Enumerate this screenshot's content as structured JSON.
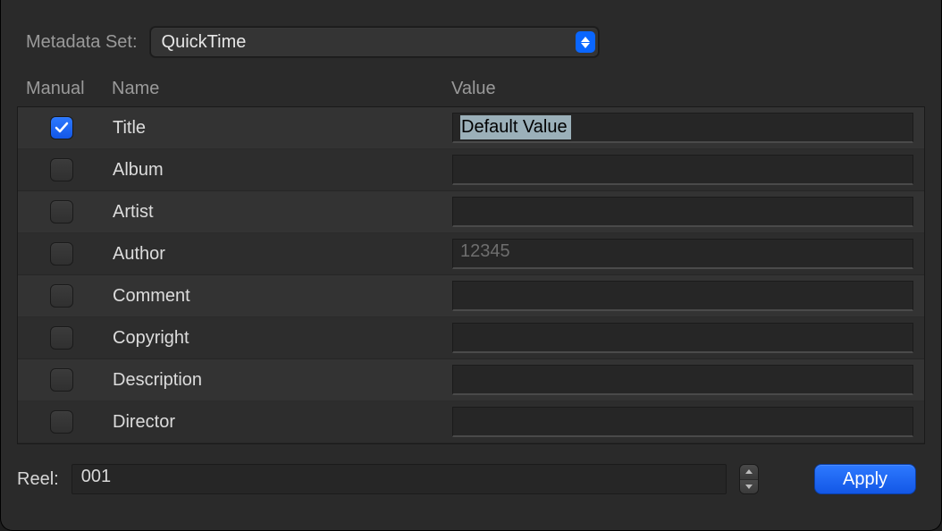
{
  "metadata_set": {
    "label": "Metadata Set:",
    "selected": "QuickTime"
  },
  "headers": {
    "manual": "Manual",
    "name": "Name",
    "value": "Value"
  },
  "rows": [
    {
      "checked": true,
      "name": "Title",
      "value": "Default Value",
      "placeholder": "",
      "selected": true
    },
    {
      "checked": false,
      "name": "Album",
      "value": "",
      "placeholder": ""
    },
    {
      "checked": false,
      "name": "Artist",
      "value": "",
      "placeholder": ""
    },
    {
      "checked": false,
      "name": "Author",
      "value": "",
      "placeholder": "12345"
    },
    {
      "checked": false,
      "name": "Comment",
      "value": "",
      "placeholder": ""
    },
    {
      "checked": false,
      "name": "Copyright",
      "value": "",
      "placeholder": ""
    },
    {
      "checked": false,
      "name": "Description",
      "value": "",
      "placeholder": ""
    },
    {
      "checked": false,
      "name": "Director",
      "value": "",
      "placeholder": ""
    }
  ],
  "reel": {
    "label": "Reel:",
    "value": "001"
  },
  "apply_label": "Apply"
}
